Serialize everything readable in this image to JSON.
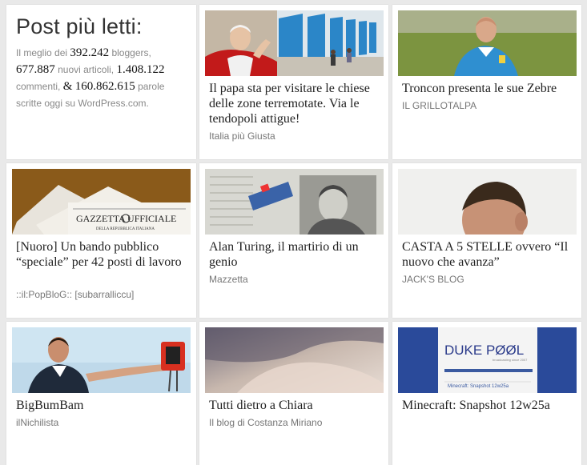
{
  "intro": {
    "title": "Post più letti:",
    "p1": "Il meglio dei",
    "bloggers": "392.242",
    "p2": "bloggers,",
    "articles": "677.887",
    "p3": "nuovi articoli,",
    "comments": "1.408.122",
    "p4": "commenti,",
    "amp": "&",
    "words": "160.862.615",
    "p5": "parole scritte oggi su WordPress.com."
  },
  "posts": [
    {
      "title": "Il papa sta per visitare le chiese delle zone terremotate. Via le tendopoli attigue!",
      "source": "Italia più Giusta",
      "thumb": "pope-tents-image"
    },
    {
      "title": "Troncon presenta le sue Zebre",
      "source": "IL GRILLOTALPA",
      "thumb": "coach-portrait-image"
    },
    {
      "title": "[Nuoro] Un bando pubblico “speciale” per 42 posti di lavoro",
      "source": "::il:PopBloG:: [subarralliccu]",
      "thumb": "gazzetta-newspaper-image",
      "newspaper_label": "GAZZETTA UFFICIALE",
      "newspaper_sub": "DELLA REPUBBLICA ITALIANA"
    },
    {
      "title": "Alan Turing, il martirio di un genio",
      "source": "Mazzetta",
      "thumb": "turing-newspaper-image"
    },
    {
      "title": "CASTA A 5 STELLE ovvero “Il nuovo che avanza”",
      "source": "JACK'S BLOG",
      "thumb": "young-man-portrait-image"
    },
    {
      "title": "BigBumBam",
      "source": "ilNichilista",
      "thumb": "speaker-podium-image"
    },
    {
      "title": "Tutti dietro a Chiara",
      "source": "Il blog di Costanza Miriano",
      "thumb": "sepia-portrait-image"
    },
    {
      "title": "Minecraft: Snapshot 12w25a",
      "source": "",
      "thumb": "duke-pool-screenshot-image",
      "logo_text": "DUKE PØØL",
      "logo_sub": "broadcasting since 2007",
      "inner_title": "Minecraft: Snapshot 12w25a"
    }
  ]
}
